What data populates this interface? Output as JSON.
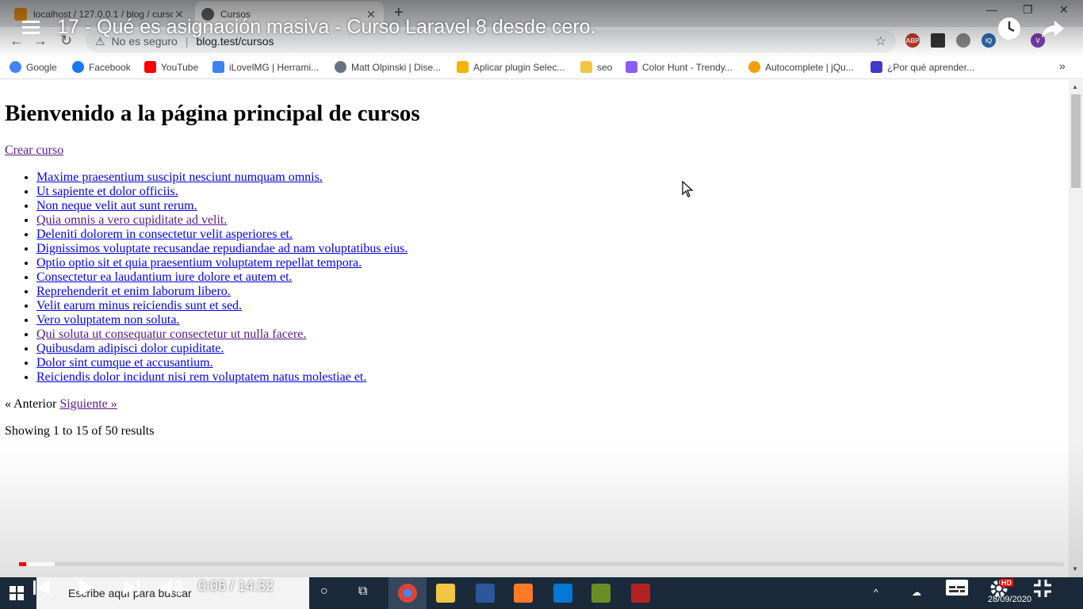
{
  "browser": {
    "tabs": [
      {
        "title": "localhost / 127.0.0.1 / blog / cursos",
        "active": false
      },
      {
        "title": "Cursos",
        "active": true
      }
    ],
    "address": {
      "security": "No es seguro",
      "url": "blog.test/cursos"
    },
    "bookmarks": [
      {
        "label": "Google",
        "color": "#4285f4"
      },
      {
        "label": "Facebook",
        "color": "#1877f2"
      },
      {
        "label": "YouTube",
        "color": "#ff0000"
      },
      {
        "label": "iLovelMG | Herrami...",
        "color": "#3b82f6"
      },
      {
        "label": "Matt Olpinski | Dise...",
        "color": "#6b7280"
      },
      {
        "label": "Aplicar plugin Selec...",
        "color": "#f5b400"
      },
      {
        "label": "seo",
        "color": "#f4c542"
      },
      {
        "label": "Color Hunt - Trendy...",
        "color": "#8b5cf6"
      },
      {
        "label": "Autocomplete | jQu...",
        "color": "#f59e0b"
      },
      {
        "label": "¿Por qué aprender...",
        "color": "#4338ca"
      }
    ]
  },
  "page": {
    "heading": "Bienvenido a la página principal de cursos",
    "create_link": "Crear curso",
    "courses": [
      {
        "title": "Maxime praesentium suscipit nesciunt numquam omnis.",
        "visited": false
      },
      {
        "title": "Ut sapiente et dolor officiis.",
        "visited": false
      },
      {
        "title": "Non neque velit aut sunt rerum.",
        "visited": false
      },
      {
        "title": "Quia omnis a vero cupiditate ad velit.",
        "visited": true
      },
      {
        "title": "Deleniti dolorem in consectetur velit asperiores et.",
        "visited": false
      },
      {
        "title": "Dignissimos voluptate recusandae repudiandae ad nam voluptatibus eius.",
        "visited": false
      },
      {
        "title": "Optio optio sit et quia praesentium voluptatem repellat tempora.",
        "visited": false
      },
      {
        "title": "Consectetur ea laudantium iure dolore et autem et.",
        "visited": false
      },
      {
        "title": "Reprehenderit et enim laborum libero.",
        "visited": false
      },
      {
        "title": "Velit earum minus reiciendis sunt et sed.",
        "visited": false
      },
      {
        "title": "Vero voluptatem non soluta.",
        "visited": false
      },
      {
        "title": "Qui soluta ut consequatur consectetur ut nulla facere.",
        "visited": true
      },
      {
        "title": "Quibusdam adipisci dolor cupiditate.",
        "visited": false
      },
      {
        "title": "Dolor sint cumque et accusantium.",
        "visited": false
      },
      {
        "title": "Reiciendis dolor incidunt nisi rem voluptatem natus molestiae et.",
        "visited": false
      }
    ],
    "pagination": {
      "previous": "« Anterior",
      "next": "Siguiente »"
    },
    "showing": "Showing 1 to 15 of 50 results"
  },
  "video": {
    "title": "17 - Qué es asignación masiva - Curso Laravel 8 desde cero.",
    "time": "0:06 / 14:32",
    "played_fraction": 0.007,
    "buffered_fraction": 0.034,
    "quality_badge": "HD"
  },
  "taskbar": {
    "search_placeholder": "Escribe aquí para buscar",
    "date": "28/09/2020"
  }
}
